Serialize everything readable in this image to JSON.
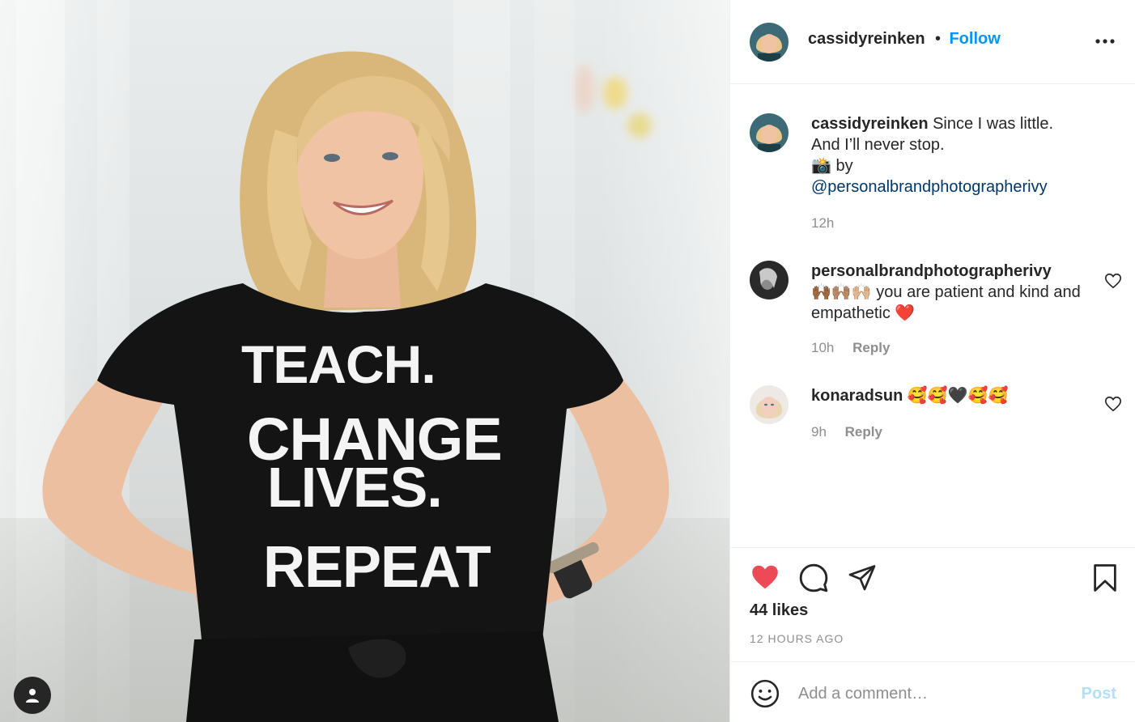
{
  "post": {
    "author": "cassidyreinken",
    "follow_label": "Follow",
    "separator": "•",
    "shirt_text": [
      "TEACH.",
      "CHANGE",
      "LIVES.",
      "REPEAT"
    ],
    "caption": {
      "username": "cassidyreinken",
      "line1": "Since I was little.",
      "line2": "And I’ll never stop.",
      "line3": "📸 by",
      "mention": "@personalbrandphotographerivy",
      "time": "12h"
    }
  },
  "comments": [
    {
      "username": "personalbrandphotographerivy",
      "emoji": "🙌🏾🙌🏽🙌🏼",
      "text": "you are patient and kind and empathetic",
      "emoji_end": "❤️",
      "time": "10h",
      "reply_label": "Reply"
    },
    {
      "username": "konaradsun",
      "text": "🥰🥰🖤🥰🥰",
      "time": "9h",
      "reply_label": "Reply"
    }
  ],
  "engagement": {
    "likes": "44 likes",
    "posted": "12 HOURS AGO",
    "liked": true,
    "heart_color": "#ed4956"
  },
  "add_comment": {
    "placeholder": "Add a comment…",
    "post_label": "Post",
    "post_color": "#b2dffc"
  },
  "icons": {
    "more": "more-horizontal-icon",
    "like": "heart-filled-icon",
    "comment": "comment-bubble-icon",
    "share": "paper-plane-icon",
    "save": "bookmark-icon",
    "emoji": "smiley-icon",
    "user": "user-tag-icon"
  }
}
